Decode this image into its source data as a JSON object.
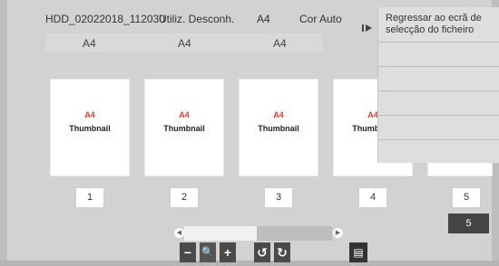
{
  "file": {
    "name": "HDD_02022018_112030",
    "usage": "Utiliz. Desconh.",
    "paper": "A4",
    "color_mode": "Cor Auto"
  },
  "sizes_row": [
    "A4",
    "A4",
    "A4"
  ],
  "thumbnails": [
    {
      "size": "A4",
      "label": "Thumbnail",
      "page": "1"
    },
    {
      "size": "A4",
      "label": "Thumbnail",
      "page": "2"
    },
    {
      "size": "A4",
      "label": "Thumbnail",
      "page": "3"
    },
    {
      "size": "A4",
      "label": "Thumbnail",
      "page": "4"
    },
    {
      "size": "",
      "label": "",
      "page": "5"
    }
  ],
  "total_pages": "5",
  "flyout": {
    "handle_icon": "play-pause-icon",
    "items": [
      "Regressar ao ecrã de selecção do ficheiro",
      "",
      "",
      "",
      "",
      ""
    ]
  },
  "toolbar": {
    "zoom_out": "−",
    "zoom": "🔍",
    "zoom_in": "+",
    "rotate_left": "↺",
    "rotate_right": "↻",
    "sheet": "▤"
  },
  "scrollbar": {
    "position": 0.0,
    "left_arrow": "◀",
    "right_arrow": "▶"
  }
}
